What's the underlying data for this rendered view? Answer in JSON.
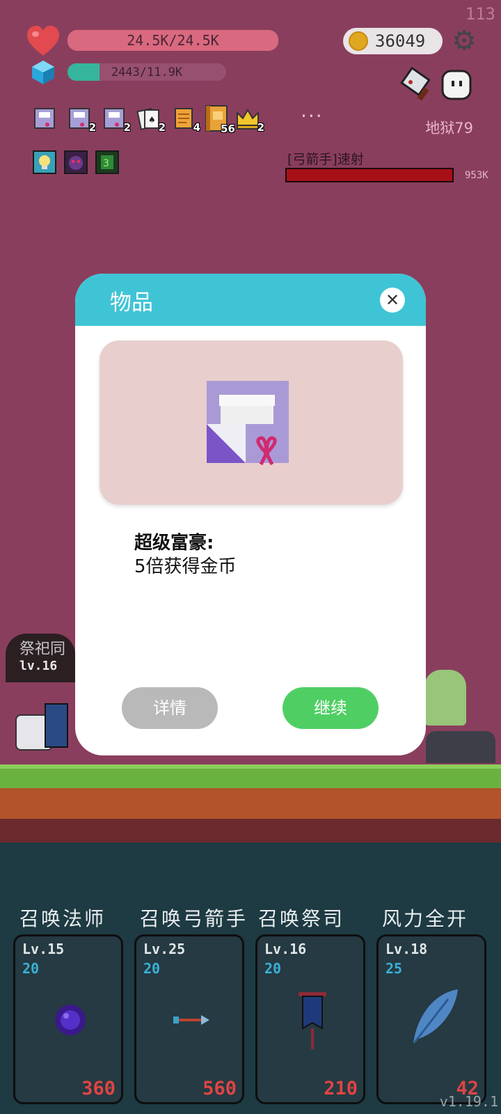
{
  "hud": {
    "fps": "113",
    "hp_text": "24.5K/24.5K",
    "hp_fraction": 1.0,
    "mana_text": "2443/11.9K",
    "mana_fraction": 0.2,
    "coins": "36049",
    "level_name": "地狱79",
    "more": "···",
    "items": [
      {
        "icon": "scroll-ribbon-icon",
        "count": ""
      },
      {
        "icon": "scroll-ribbon-icon",
        "count": "2"
      },
      {
        "icon": "scroll-ribbon-icon",
        "count": "2"
      },
      {
        "icon": "playing-cards-icon",
        "count": "2"
      },
      {
        "icon": "orange-scroll-icon",
        "count": "4"
      },
      {
        "icon": "spellbook-icon",
        "count": "56"
      },
      {
        "icon": "crown-icon",
        "count": "2"
      }
    ],
    "buffs": [
      "lightbulb-buff-icon",
      "demon-face-buff-icon",
      "green-rune-buff-icon"
    ],
    "boss": {
      "name": "[弓箭手]速射",
      "hp": "953K",
      "hp_fraction": 1.0
    }
  },
  "scene": {
    "enemy_label": "祭祀同",
    "enemy_level": "lv.16"
  },
  "dialog": {
    "title": "物品",
    "close_icon": "close-icon",
    "item_icon": "gift-scroll-icon",
    "item_name": "超级富豪:",
    "item_desc": "5倍获得金币",
    "detail_label": "详情",
    "continue_label": "继续"
  },
  "skills": [
    {
      "name": "召唤法师",
      "level": "Lv.15",
      "mana": "20",
      "cost": "360",
      "icon": "dark-orb-icon"
    },
    {
      "name": "召唤弓箭手",
      "level": "Lv.25",
      "mana": "20",
      "cost": "560",
      "icon": "arrow-icon"
    },
    {
      "name": "召唤祭司",
      "level": "Lv.16",
      "mana": "20",
      "cost": "210",
      "icon": "banner-icon"
    },
    {
      "name": "风力全开",
      "level": "Lv.18",
      "mana": "25",
      "cost": "42",
      "icon": "feather-icon"
    }
  ],
  "version": "v1.19.1",
  "colors": {
    "accent": "#3fc4d6",
    "continue": "#4fcf63",
    "detail": "#b9b9b9",
    "background": "#8a3e5d"
  }
}
